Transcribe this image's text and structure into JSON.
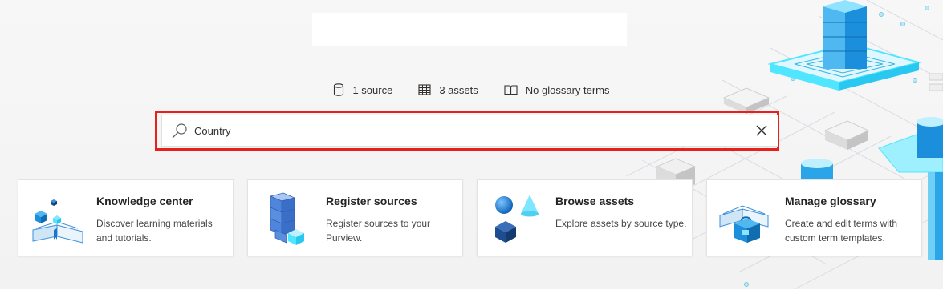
{
  "stats": [
    {
      "icon": "database-icon",
      "label": "1 source"
    },
    {
      "icon": "table-icon",
      "label": "3 assets"
    },
    {
      "icon": "book-icon",
      "label": "No glossary terms"
    }
  ],
  "search": {
    "value": "Country",
    "placeholder": ""
  },
  "cards": [
    {
      "title": "Knowledge center",
      "description": "Discover learning materials and tutorials."
    },
    {
      "title": "Register sources",
      "description": "Register sources to your Purview."
    },
    {
      "title": "Browse assets",
      "description": "Explore assets by source type."
    },
    {
      "title": "Manage glossary",
      "description": "Create and edit terms with custom term templates."
    }
  ],
  "colors": {
    "highlight": "#e8201c",
    "accent": "#0078d4",
    "cyan": "#50e6ff"
  }
}
